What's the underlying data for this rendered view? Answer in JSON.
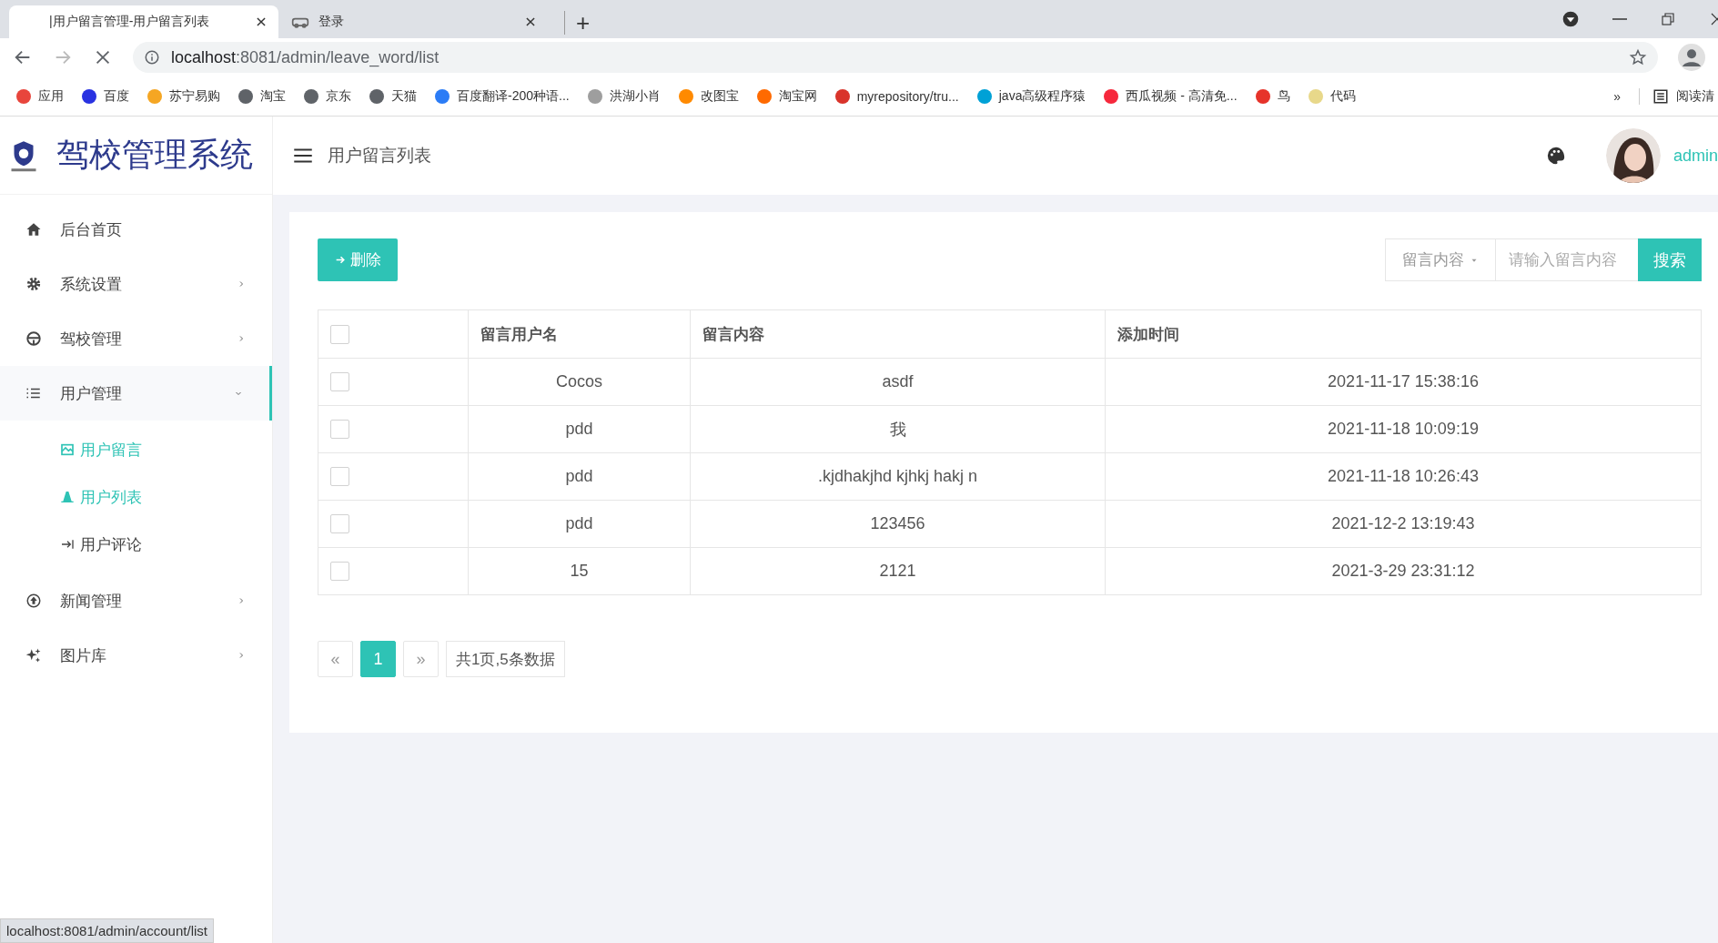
{
  "browser": {
    "tabs": [
      {
        "title": "|用户留言管理-用户留言列表",
        "selected": true
      },
      {
        "title": "登录",
        "selected": false
      }
    ],
    "new_tab": "+",
    "url": {
      "host": "localhost",
      "rest": ":8081/admin/leave_word/list"
    },
    "bookmarks": [
      {
        "label": "应用",
        "color": "#e8453c"
      },
      {
        "label": "百度",
        "color": "#2932e1"
      },
      {
        "label": "苏宁易购",
        "color": "#f5a623"
      },
      {
        "label": "淘宝",
        "color": "#5f6368"
      },
      {
        "label": "京东",
        "color": "#5f6368"
      },
      {
        "label": "天猫",
        "color": "#5f6368"
      },
      {
        "label": "百度翻译-200种语...",
        "color": "#2b7cf6"
      },
      {
        "label": "洪湖小肖",
        "color": "#9e9e9e"
      },
      {
        "label": "改图宝",
        "color": "#ff8a00"
      },
      {
        "label": "淘宝网",
        "color": "#ff6a00"
      },
      {
        "label": "myrepository/tru...",
        "color": "#d9342b"
      },
      {
        "label": "java高级程序猿",
        "color": "#00a1d6"
      },
      {
        "label": "西瓜视频 - 高清免...",
        "color": "#f6283c"
      },
      {
        "label": "鸟",
        "color": "#e6332a"
      },
      {
        "label": "代码",
        "color": "#e8d88a"
      }
    ],
    "more": "»",
    "reading_list": "阅读清",
    "status_url": "localhost:8081/admin/account/list"
  },
  "app": {
    "title": "驾校管理系统",
    "page_title": "用户留言列表",
    "user": "admin"
  },
  "sidebar": [
    {
      "label": "后台首页",
      "kind": "link"
    },
    {
      "label": "系统设置",
      "kind": "group",
      "expanded": false
    },
    {
      "label": "驾校管理",
      "kind": "group",
      "expanded": false
    },
    {
      "label": "用户管理",
      "kind": "group",
      "expanded": true,
      "children": [
        {
          "label": "用户留言",
          "highlighted": true
        },
        {
          "label": "用户列表",
          "highlighted": true
        },
        {
          "label": "用户评论",
          "highlighted": false
        }
      ]
    },
    {
      "label": "新闻管理",
      "kind": "group",
      "expanded": false
    },
    {
      "label": "图片库",
      "kind": "group",
      "expanded": false
    }
  ],
  "toolbar": {
    "delete_button": "删除",
    "search_field": "留言内容",
    "search_placeholder": "请输入留言内容",
    "search_button": "搜索"
  },
  "table": {
    "header_checked": false,
    "columns": [
      "留言用户名",
      "留言内容",
      "添加时间"
    ],
    "rows": [
      {
        "checked": false,
        "cells": [
          "Cocos",
          "asdf",
          "2021-11-17 15:38:16"
        ]
      },
      {
        "checked": false,
        "cells": [
          "pdd",
          "我",
          "2021-11-18 10:09:19"
        ]
      },
      {
        "checked": false,
        "cells": [
          "pdd",
          ".kjdhakjhd kjhkj hakj n",
          "2021-11-18 10:26:43"
        ]
      },
      {
        "checked": false,
        "cells": [
          "pdd",
          "123456",
          "2021-12-2 13:19:43"
        ]
      },
      {
        "checked": false,
        "cells": [
          "15",
          "2121",
          "2021-3-29 23:31:12"
        ]
      }
    ]
  },
  "pagination": {
    "prev": "«",
    "pages": [
      {
        "label": "1",
        "selected": true
      }
    ],
    "next": "»",
    "summary": "共1页,5条数据"
  }
}
